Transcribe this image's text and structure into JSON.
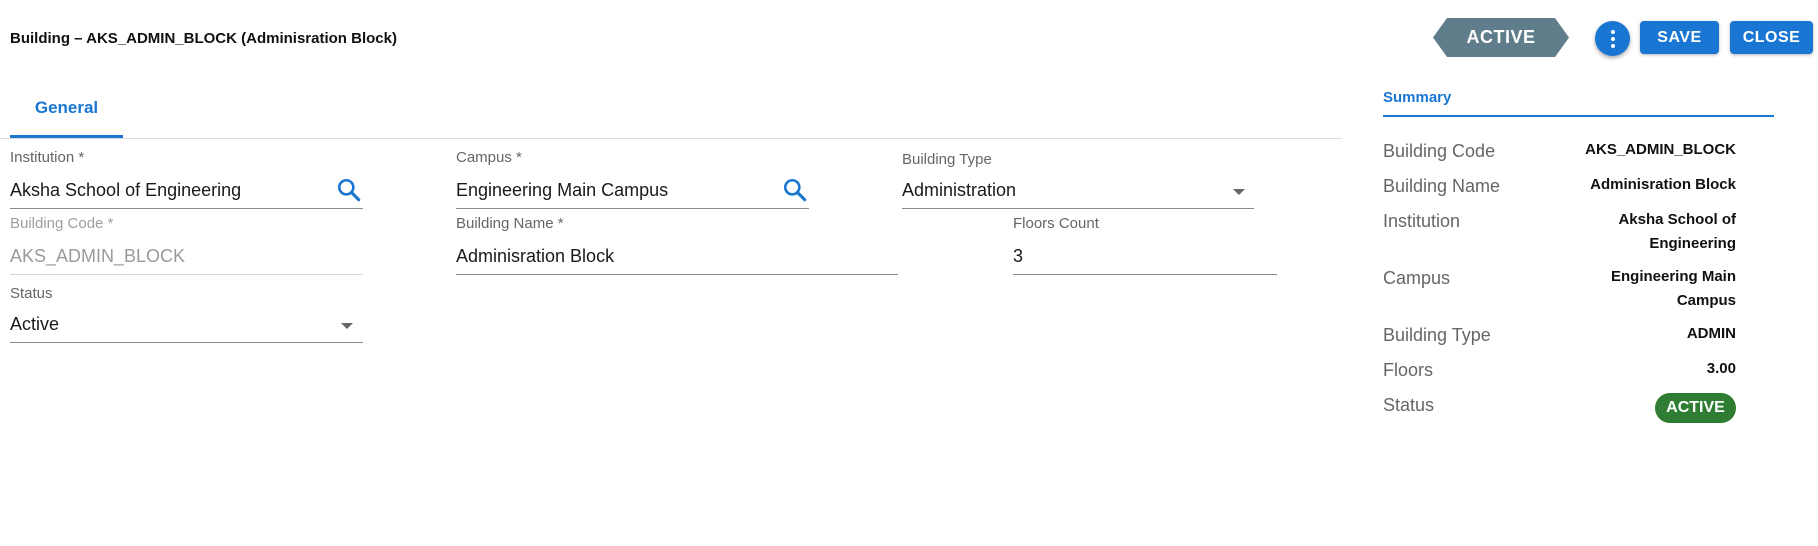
{
  "header": {
    "title": "Building – AKS_ADMIN_BLOCK (Adminisration Block)",
    "status_flag": "ACTIVE",
    "save_label": "SAVE",
    "close_label": "CLOSE",
    "more_icon": "more-vert-icon"
  },
  "tabs": [
    {
      "label": "General",
      "active": true
    }
  ],
  "form": {
    "institution": {
      "label": "Institution *",
      "value": "Aksha School of Engineering"
    },
    "campus": {
      "label": "Campus *",
      "value": "Engineering Main Campus"
    },
    "building_type": {
      "label": "Building Type",
      "value": "Administration"
    },
    "building_code": {
      "label": "Building Code *",
      "value": "AKS_ADMIN_BLOCK",
      "disabled": true
    },
    "building_name": {
      "label": "Building Name *",
      "value": "Adminisration Block"
    },
    "floors_count": {
      "label": "Floors Count",
      "value": "3"
    },
    "status": {
      "label": "Status",
      "value": "Active"
    }
  },
  "summary": {
    "title": "Summary",
    "rows": [
      {
        "label": "Building Code",
        "value": "AKS_ADMIN_BLOCK"
      },
      {
        "label": "Building Name",
        "value": "Adminisration Block"
      },
      {
        "label": "Institution",
        "value": "Aksha School of Engineering"
      },
      {
        "label": "Campus",
        "value": "Engineering Main Campus"
      },
      {
        "label": "Building Type",
        "value": "ADMIN"
      },
      {
        "label": "Floors",
        "value": "3.00"
      },
      {
        "label": "Status",
        "value": "ACTIVE"
      }
    ]
  },
  "colors": {
    "accent": "#1976d2",
    "status_flag": "#607d8b",
    "status_badge": "#2e7d32"
  }
}
